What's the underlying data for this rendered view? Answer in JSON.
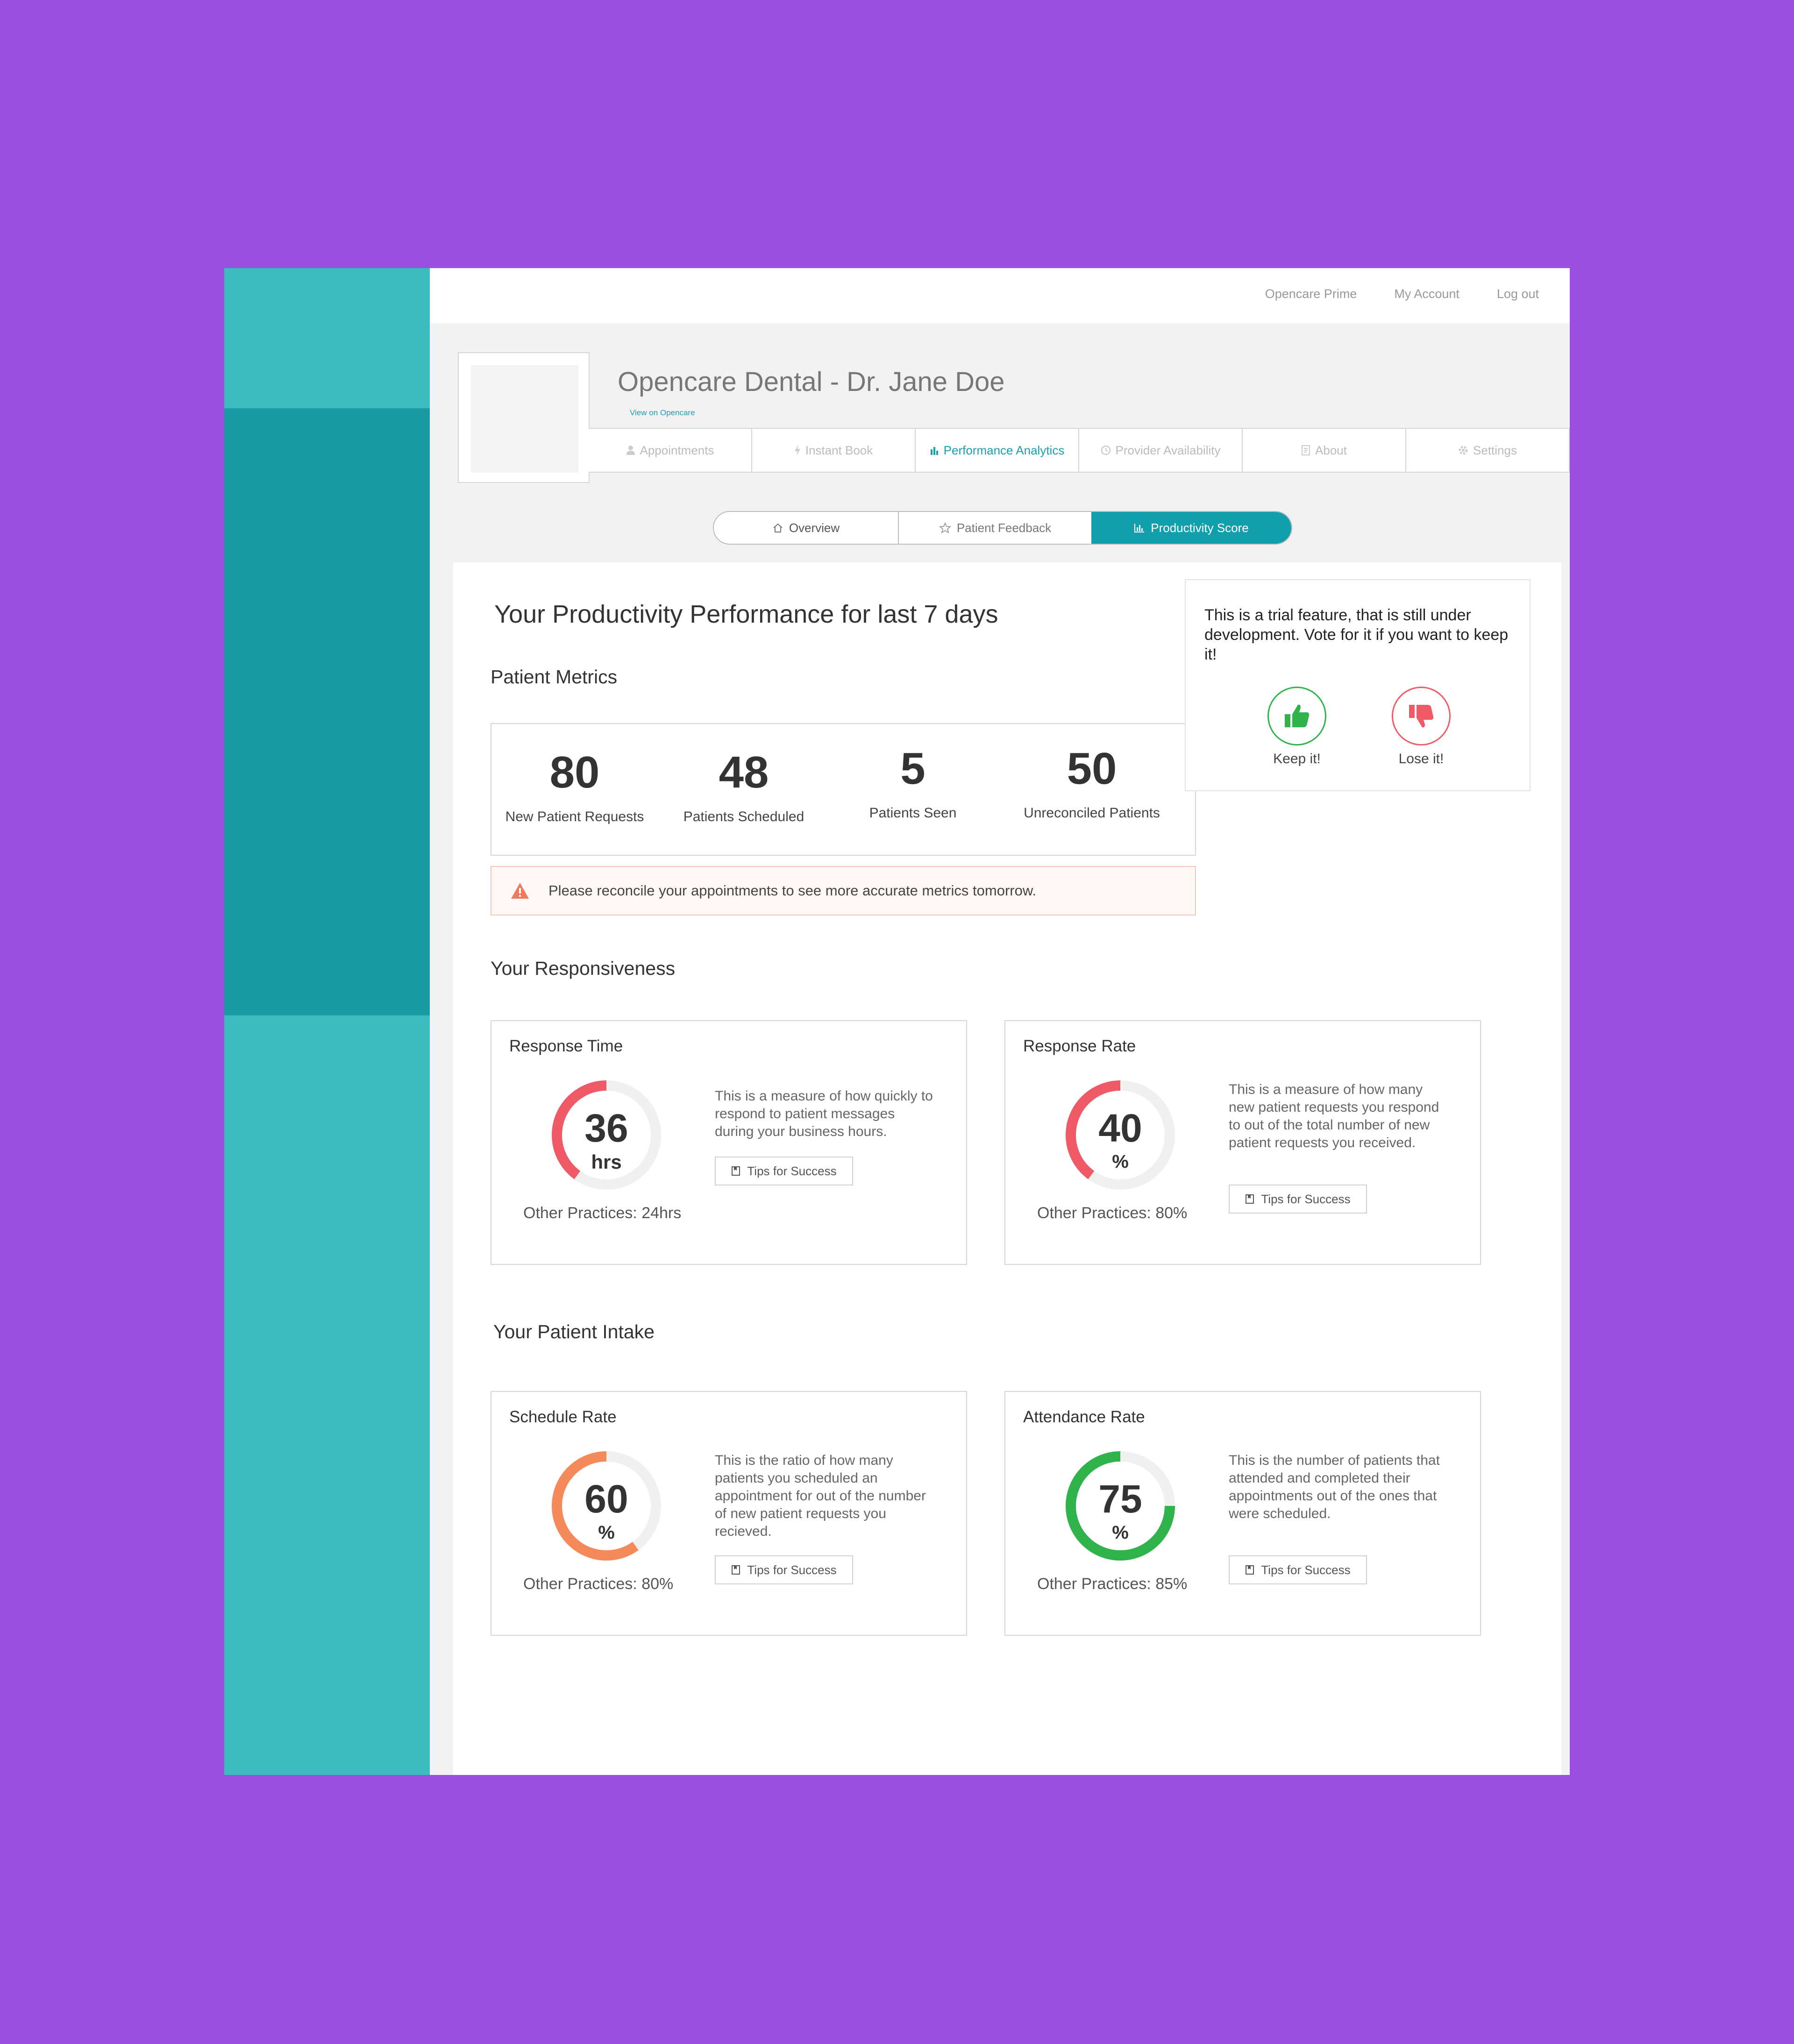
{
  "topbar": {
    "links": [
      "Opencare Prime",
      "My Account",
      "Log out"
    ]
  },
  "header": {
    "title": "Opencare Dental - Dr. Jane Doe",
    "view_link": "View on Opencare"
  },
  "nav": {
    "tabs": [
      {
        "label": "Appointments",
        "icon": "user-icon"
      },
      {
        "label": "Instant Book",
        "icon": "bolt-icon"
      },
      {
        "label": "Performance Analytics",
        "icon": "bar-chart-icon"
      },
      {
        "label": "Provider Availability",
        "icon": "clock-icon"
      },
      {
        "label": "About",
        "icon": "document-icon"
      },
      {
        "label": "Settings",
        "icon": "gear-icon"
      }
    ],
    "active": "Performance Analytics"
  },
  "subtabs": [
    {
      "label": "Overview",
      "icon": "home-icon"
    },
    {
      "label": "Patient Feedback",
      "icon": "star-icon"
    },
    {
      "label": "Productivity Score",
      "icon": "bar-chart-icon"
    }
  ],
  "main": {
    "title": "Your Productivity Performance for last 7 days",
    "patient_metrics": {
      "title": "Patient Metrics",
      "items": [
        {
          "value": "80",
          "label": "New Patient Requests"
        },
        {
          "value": "48",
          "label": "Patients Scheduled"
        },
        {
          "value": "5",
          "label": "Patients Seen"
        },
        {
          "value": "50",
          "label": "Unreconciled Patients"
        }
      ]
    },
    "alert": "Please reconcile your appointments to see more accurate metrics tomorrow.",
    "trial": {
      "message": "This is a trial feature, that is still under development. Vote for it if you want to keep it!",
      "keep": "Keep it!",
      "lose": "Lose it!"
    },
    "responsiveness": {
      "title": "Your Responsiveness",
      "cards": [
        {
          "title": "Response Time",
          "value": "36",
          "unit": "hrs",
          "fraction": 0.4,
          "color": "#f05a67",
          "other": "Other Practices: 24hrs",
          "desc": "This is a measure of how quickly to respond to patient messages during your business hours.",
          "tips": "Tips for Success"
        },
        {
          "title": "Response Rate",
          "value": "40",
          "unit": "%",
          "fraction": 0.4,
          "color": "#f05a67",
          "other": "Other Practices: 80%",
          "desc": "This is a measure of how many new patient requests you respond to out of the total number of new patient requests you received.",
          "tips": "Tips for Success"
        }
      ]
    },
    "intake": {
      "title": "Your Patient Intake",
      "cards": [
        {
          "title": "Schedule Rate",
          "value": "60",
          "unit": "%",
          "fraction": 0.6,
          "color": "#f5895a",
          "other": "Other Practices: 80%",
          "desc": "This is the ratio of how many patients you scheduled an appointment for out of the number of new patient requests you recieved.",
          "tips": "Tips for Success"
        },
        {
          "title": "Attendance Rate",
          "value": "75",
          "unit": "%",
          "fraction": 0.75,
          "color": "#2fb34a",
          "other": "Other Practices: 85%",
          "desc": "This is the number of patients that attended and completed their appointments out of the ones that were scheduled.",
          "tips": "Tips for Success"
        }
      ]
    }
  }
}
